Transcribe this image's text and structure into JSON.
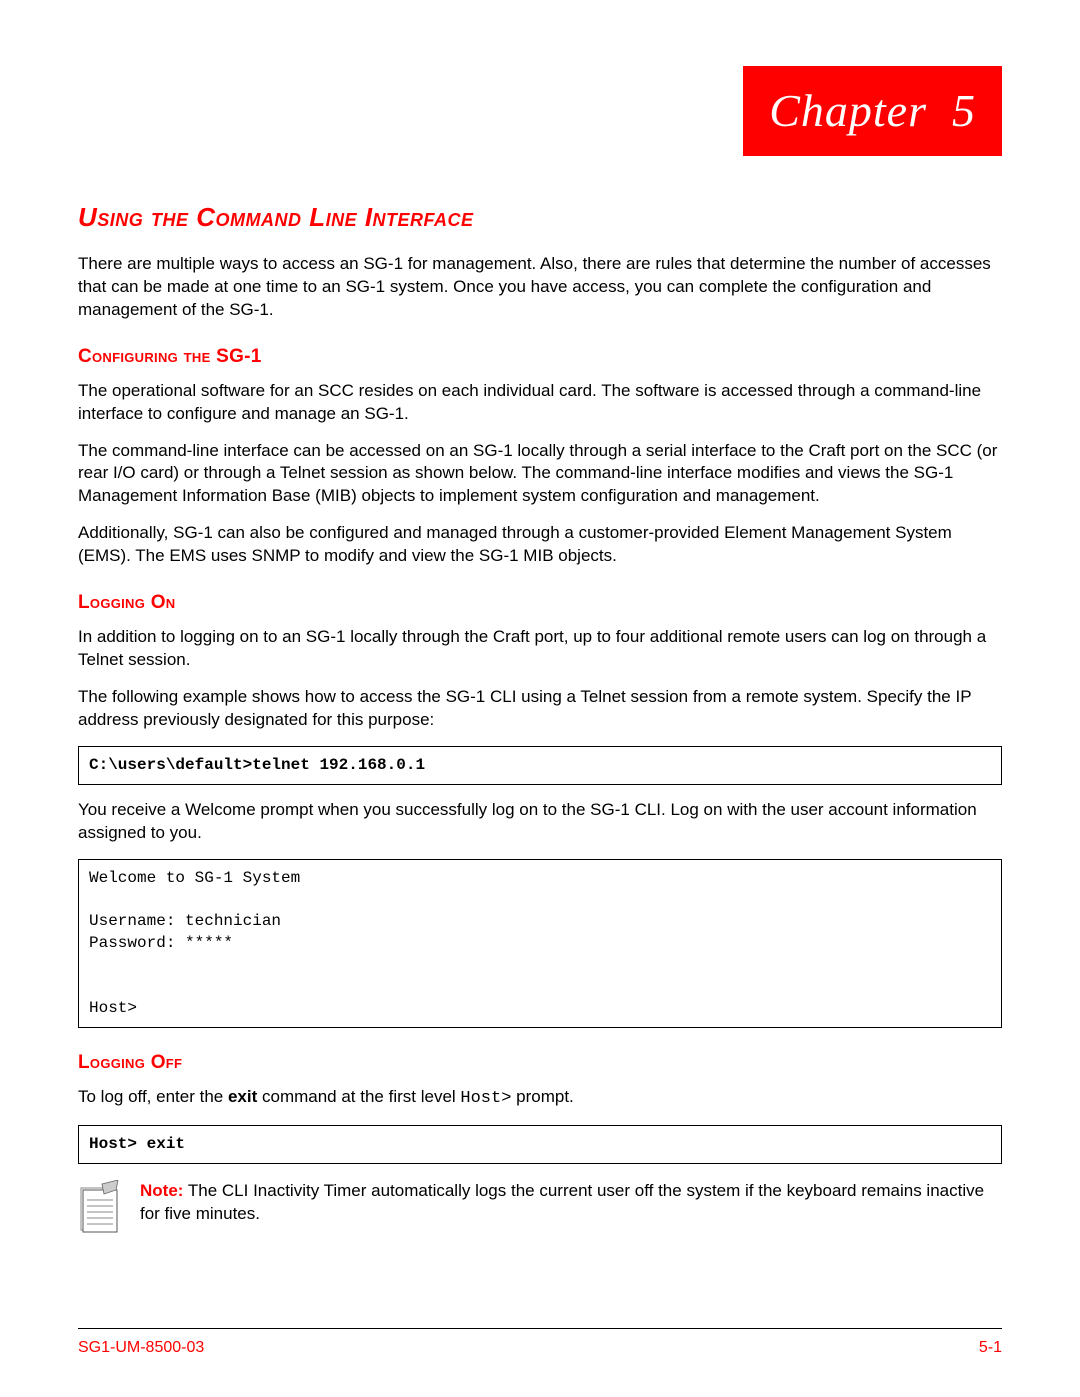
{
  "chapter": {
    "label": "Chapter",
    "number": "5"
  },
  "title": "Using the Command Line Interface",
  "intro": "There are multiple ways to access an SG-1 for management. Also, there are rules that determine the number of accesses that can be made at one time to an SG-1 system. Once you have access, you can complete the configuration and management of the SG-1.",
  "config": {
    "heading": "Configuring the SG-1",
    "p1": "The operational software for an SCC resides on each individual card. The software is accessed through a command-line interface to configure and manage an SG-1.",
    "p2": "The command-line interface can be accessed on an SG-1 locally through a serial interface to the Craft port on the SCC (or rear I/O card) or through a Telnet session as shown below. The command-line interface modifies and views the SG-1 Management Information Base (MIB) objects to implement system configuration and management.",
    "p3": "Additionally, SG-1 can also be configured and managed through a customer-provided Element Management System (EMS). The EMS uses SNMP to modify and view the SG-1 MIB objects."
  },
  "loggingOn": {
    "heading": "Logging On",
    "p1": "In addition to logging on to an SG-1 locally through the Craft port, up to four additional remote users can log on through a Telnet session.",
    "p2": "The following example shows how to access the SG-1 CLI using a Telnet session from a remote system. Specify the IP address previously designated for this purpose:",
    "cmd1": "C:\\users\\default>telnet 192.168.0.1",
    "p3": "You receive a Welcome prompt when you successfully log on to the SG-1 CLI. Log on with the user account information assigned to you.",
    "session": "Welcome to SG-1 System\n\nUsername: technician\nPassword: *****\n\n\nHost>"
  },
  "loggingOff": {
    "heading": "Logging Off",
    "p1_pre": "To log off, enter the ",
    "p1_cmd": "exit",
    "p1_mid": " command at the first level ",
    "p1_prompt": "Host>",
    "p1_post": " prompt.",
    "cmd": "Host> exit"
  },
  "note": {
    "label": "Note:",
    "text": " The CLI Inactivity Timer automatically logs the current user off the system if the keyboard remains inactive for five minutes."
  },
  "footer": {
    "doc": "SG1-UM-8500-03",
    "page": "5-1"
  }
}
